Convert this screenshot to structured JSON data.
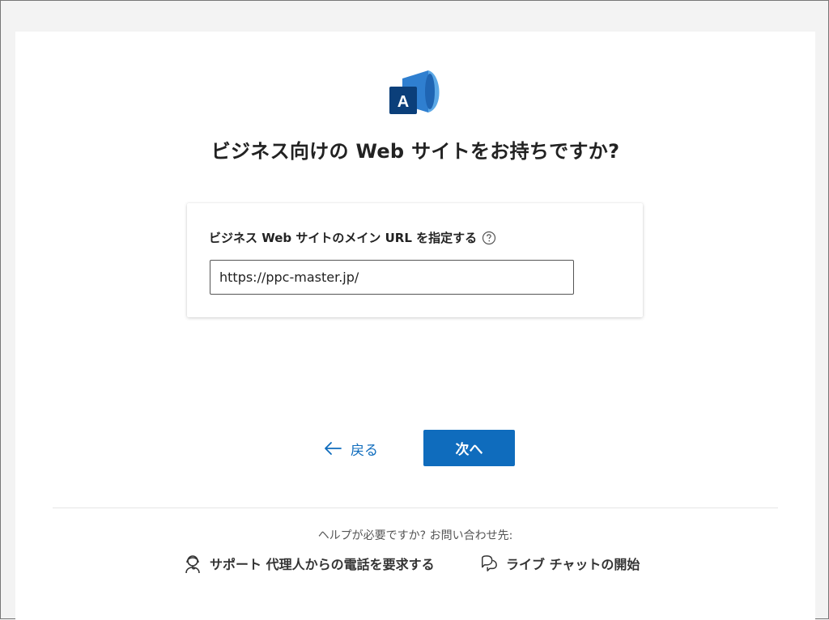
{
  "page": {
    "title": "ビジネス向けの Web サイトをお持ちですか?",
    "logo_letter": "A"
  },
  "form": {
    "label": "ビジネス Web サイトのメイン URL を指定する",
    "url_value": "https://ppc-master.jp/",
    "help_icon": "question-circle-icon"
  },
  "actions": {
    "back_label": "戻る",
    "next_label": "次へ"
  },
  "footer": {
    "help_text": "ヘルプが必要ですか? お問い合わせ先:",
    "support_label": "サポート 代理人からの電話を要求する",
    "chat_label": "ライブ チャットの開始"
  },
  "colors": {
    "accent": "#0f6cbd",
    "logo_dark": "#0b3f7a",
    "logo_light": "#5ba8e6"
  }
}
